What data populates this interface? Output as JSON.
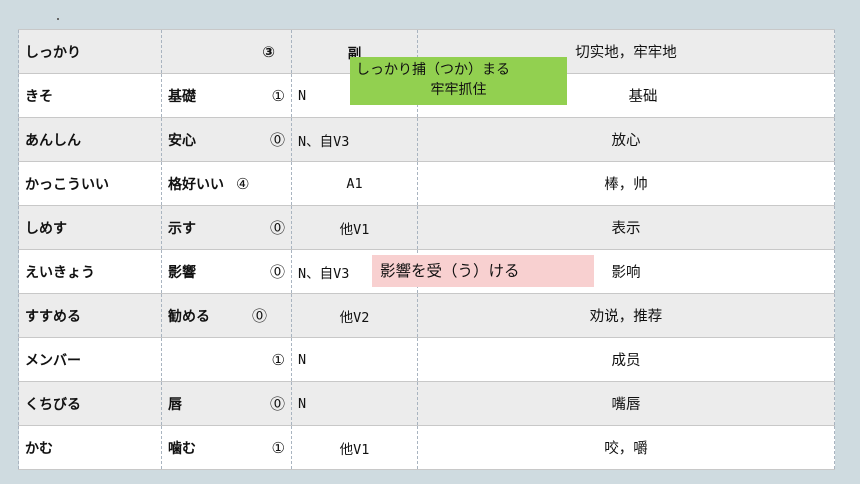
{
  "rows": [
    {
      "reading": "しっかり",
      "kanji": "",
      "accent": "③",
      "pos": "副",
      "meaning": "切实地，牢牢地"
    },
    {
      "reading": "きそ",
      "kanji": "基礎",
      "accent": "①",
      "pos": "N",
      "meaning": "基础"
    },
    {
      "reading": "あんしん",
      "kanji": "安心",
      "accent": "⓪",
      "pos": "N、自V3",
      "meaning": "放心"
    },
    {
      "reading": "かっこういい",
      "kanji": "格好いい",
      "accent": "④",
      "pos": "A1",
      "meaning": "棒，帅"
    },
    {
      "reading": "しめす",
      "kanji": "示す",
      "accent": "⓪",
      "pos": "他V1",
      "meaning": "表示"
    },
    {
      "reading": "えいきょう",
      "kanji": "影響",
      "accent": "⓪",
      "pos": "N、自V3",
      "meaning": "影响"
    },
    {
      "reading": "すすめる",
      "kanji": "勧める",
      "accent": "⓪",
      "pos": "他V2",
      "meaning": "劝说，推荐"
    },
    {
      "reading": "メンバー",
      "kanji": "",
      "accent": "①",
      "pos": "N",
      "meaning": "成员"
    },
    {
      "reading": "くちびる",
      "kanji": "唇",
      "accent": "⓪",
      "pos": "N",
      "meaning": "嘴唇"
    },
    {
      "reading": "かむ",
      "kanji": "噛む",
      "accent": "①",
      "pos": "他V1",
      "meaning": "咬，嚼"
    }
  ],
  "notes": {
    "green_line1": "しっかり捕（つか）まる",
    "green_line2": "牢牢抓住",
    "pink": "影響を受（う）ける"
  },
  "colors": {
    "green_note": "#92d050",
    "pink_note": "#f8d0d0",
    "row_gray": "#ececec"
  }
}
